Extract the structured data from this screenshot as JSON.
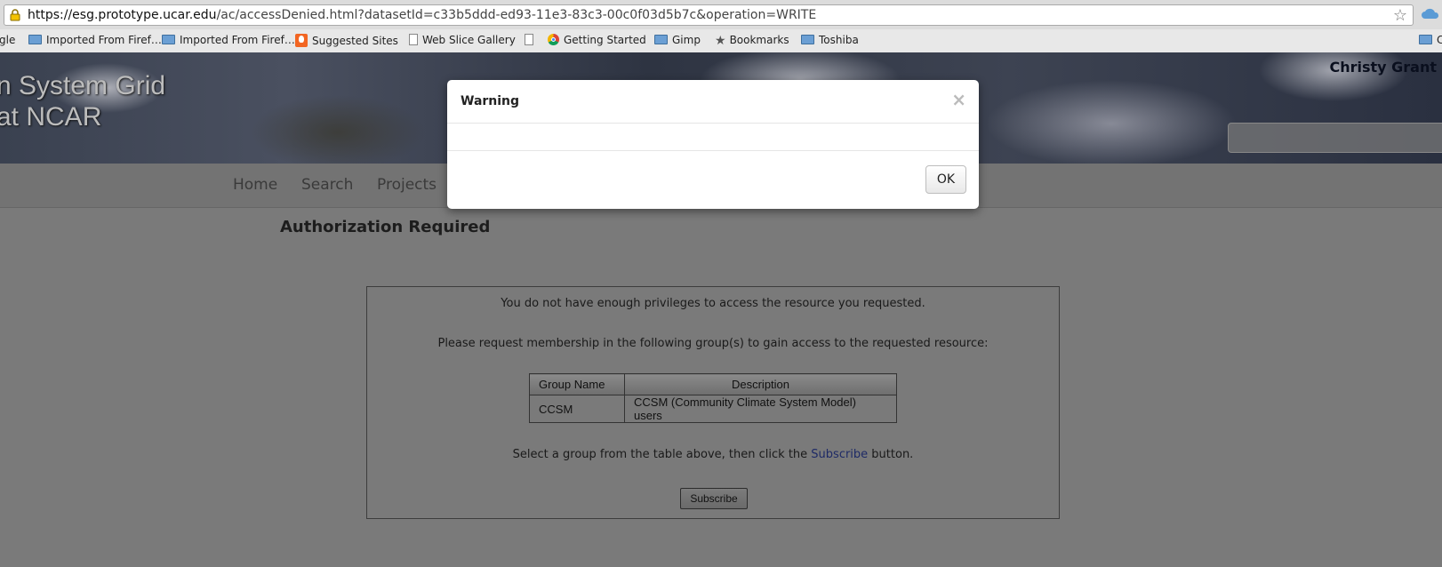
{
  "browser": {
    "url_host": "https://esg.prototype.ucar.edu",
    "url_path": "/ac/accessDenied.html?datasetId=c33b5ddd-ed93-11e3-83c3-00c0f03d5b7c&operation=WRITE",
    "bookmarks": [
      {
        "label": "gle",
        "icon": "none"
      },
      {
        "label": "Imported From Firef…",
        "icon": "folder"
      },
      {
        "label": "Imported From Firef…",
        "icon": "folder"
      },
      {
        "label": "Suggested Sites",
        "icon": "suggested-sites"
      },
      {
        "label": "Web Slice Gallery",
        "icon": "page"
      },
      {
        "label": "",
        "icon": "page"
      },
      {
        "label": "Getting Started",
        "icon": "chrome"
      },
      {
        "label": "Gimp",
        "icon": "folder"
      },
      {
        "label": "Bookmarks",
        "icon": "star"
      },
      {
        "label": "Toshiba",
        "icon": "folder"
      },
      {
        "label": "C",
        "icon": "folder"
      }
    ]
  },
  "site": {
    "brand_line1": "n System Grid",
    "brand_line2": "at NCAR",
    "user_name": "Christy Grant"
  },
  "nav": {
    "items": [
      "Home",
      "Search",
      "Projects"
    ]
  },
  "main": {
    "heading": "Authorization Required",
    "privilege_message": "You do not have enough privileges to access the resource you requested.",
    "request_message": "Please request membership in the following group(s) to gain access to the requested resource:",
    "table": {
      "headers": [
        "Group Name",
        "Description"
      ],
      "rows": [
        [
          "CCSM",
          "CCSM (Community Climate System Model) users"
        ]
      ]
    },
    "instruction_prefix": "Select a group from the table above, then click the ",
    "instruction_link": "Subscribe",
    "instruction_suffix": " button.",
    "subscribe_label": "Subscribe"
  },
  "modal": {
    "title": "Warning",
    "close_symbol": "×",
    "body": "",
    "ok_label": "OK"
  },
  "colors": {
    "overlay_gray": "#7a7a7a",
    "link": "#1e2a66",
    "modal_bg": "#ffffff"
  }
}
